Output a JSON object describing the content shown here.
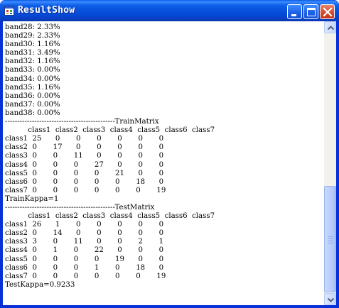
{
  "window": {
    "title": "ResultShow"
  },
  "title_buttons": {
    "minimize": "minimize-icon",
    "maximize": "maximize-icon",
    "close": "close-icon"
  },
  "output_lines": [
    "band28: 2.33%",
    "band29: 2.33%",
    "band30: 1.16%",
    "band31: 3.49%",
    "band32: 1.16%",
    "band33: 0.00%",
    "band34: 0.00%",
    "band35: 1.16%",
    "band36: 0.00%",
    "band37: 0.00%",
    "band38: 0.00%",
    "---------------------------------------------TrainMatrix",
    "          class1  class2  class3  class4  class5  class6  class7",
    "class1  25      0       0       0       0       0       0",
    "class2  0       17      0       0       0       0       0",
    "class3  0       0       11      0       0       0       0",
    "class4  0       0       0       27      0       0       0",
    "class5  0       0       0       0       21      0       0",
    "class6  0       0       0       0       0       18      0",
    "class7  0       0       0       0       0       0       19",
    "TrainKappa=1",
    "---------------------------------------------TestMatrix",
    "          class1  class2  class3  class4  class5  class6  class7",
    "class1  26      1       0       0       0       0       0",
    "class2  0       14      0       0       0       0       0",
    "class3  3       0       11      0       0       2       1",
    "class4  0       1       0       22      0       0       0",
    "class5  0       0       0       0       19      0       0",
    "class6  0       0       0       1       0       18      0",
    "class7  0       0       0       0       0       0       19",
    "TestKappa=0.9233"
  ],
  "scroll": {
    "position_fraction": 1.0
  }
}
